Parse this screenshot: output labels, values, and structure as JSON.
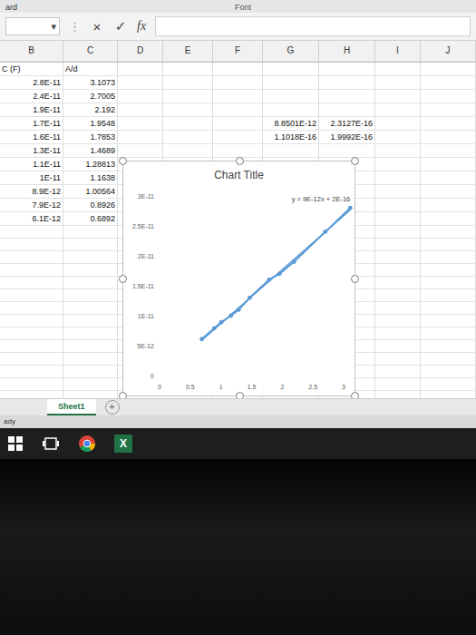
{
  "top_strip": {
    "left": "ard",
    "center": "Font"
  },
  "formula_bar": {
    "name_box_arrow": "▾",
    "more": "⋮",
    "cancel": "×",
    "enter": "✓",
    "fx": "fx",
    "value": ""
  },
  "columns": [
    "B",
    "C",
    "D",
    "E",
    "F",
    "G",
    "H",
    "I",
    "J"
  ],
  "rows": [
    {
      "cells": [
        "C (F)",
        "A/d",
        "",
        "",
        "",
        "",
        "",
        "",
        ""
      ]
    },
    {
      "cells": [
        "2.8E-11",
        "3.1073",
        "",
        "",
        "",
        "",
        "",
        "",
        ""
      ]
    },
    {
      "cells": [
        "2.4E-11",
        "2.7005",
        "",
        "",
        "",
        "",
        "",
        "",
        ""
      ]
    },
    {
      "cells": [
        "1.9E-11",
        "2.192",
        "",
        "",
        "",
        "",
        "",
        "",
        ""
      ]
    },
    {
      "cells": [
        "1.7E-11",
        "1.9548",
        "",
        "",
        "",
        "8.8501E-12",
        "2.3127E-16",
        "",
        ""
      ]
    },
    {
      "cells": [
        "1.6E-11",
        "1.7853",
        "",
        "",
        "",
        "1.1018E-16",
        "1.9992E-16",
        "",
        ""
      ]
    },
    {
      "cells": [
        "1.3E-11",
        "1.4689",
        "",
        "",
        "",
        "",
        "",
        "",
        ""
      ]
    },
    {
      "cells": [
        "1.1E-11",
        "1.28813",
        "",
        "",
        "",
        "",
        "",
        "",
        ""
      ]
    },
    {
      "cells": [
        "1E-11",
        "1.1638",
        "",
        "",
        "",
        "",
        "",
        "",
        ""
      ]
    },
    {
      "cells": [
        "8.9E-12",
        "1.00564",
        "",
        "",
        "",
        "",
        "",
        "",
        ""
      ]
    },
    {
      "cells": [
        "7.9E-12",
        "0.8926",
        "",
        "",
        "",
        "",
        "",
        "",
        ""
      ]
    },
    {
      "cells": [
        "6.1E-12",
        "0.6892",
        "",
        "",
        "",
        "",
        "",
        "",
        ""
      ]
    }
  ],
  "chart": {
    "title": "Chart Title",
    "y_ticks": [
      "3E-11",
      "2.5E-11",
      "2E-11",
      "1.5E-11",
      "1E-11",
      "5E-12",
      "0"
    ],
    "x_ticks": [
      "0",
      "0.5",
      "1",
      "1.5",
      "2",
      "2.5",
      "3"
    ],
    "trendline_label": "y = 9E-12x + 2E-16",
    "series": [
      {
        "color": "#5b9bd5",
        "x": [
          3.1073,
          2.7005,
          2.192,
          1.9548,
          1.7853,
          1.4689,
          1.28813,
          1.1638,
          1.00564,
          0.8926,
          0.6892
        ],
        "y": [
          2.8e-11,
          2.4e-11,
          1.9e-11,
          1.7e-11,
          1.6e-11,
          1.3e-11,
          1.1e-11,
          1e-11,
          8.9e-12,
          7.9e-12,
          6.1e-12
        ]
      }
    ]
  },
  "sheet_tabs": [
    {
      "label": "Sheet1",
      "selected": true
    }
  ],
  "add_sheet": "+",
  "status": "ady",
  "taskbar": {
    "excel_letter": "X"
  }
}
